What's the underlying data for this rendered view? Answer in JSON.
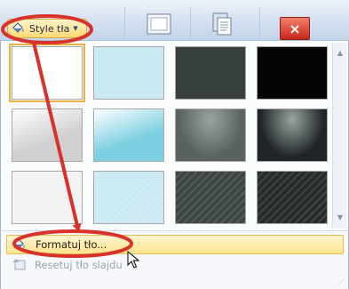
{
  "ribbon": {
    "style_button_label": "Style tła",
    "close_label": "×"
  },
  "gallery": {
    "thumbnails": [
      {
        "fill": "#ffffff",
        "pattern": "plain"
      },
      {
        "fill": "#cbe9f3",
        "pattern": "plain"
      },
      {
        "fill": "#38403f",
        "pattern": "plain"
      },
      {
        "fill": "#050505",
        "pattern": "plain"
      },
      {
        "fill": "#d0d0d0",
        "pattern": "gradient-light"
      },
      {
        "fill": "#7ccfe0",
        "pattern": "gradient-light"
      },
      {
        "fill": "#5a6261",
        "pattern": "radial-dark"
      },
      {
        "fill": "#1f2526",
        "pattern": "radial-dark"
      },
      {
        "fill": "#f3f3f3",
        "pattern": "diagonal"
      },
      {
        "fill": "#cbe9f3",
        "pattern": "diagonal"
      },
      {
        "fill": "#3e4645",
        "pattern": "diagonal"
      },
      {
        "fill": "#262b2c",
        "pattern": "diagonal"
      }
    ]
  },
  "menu": {
    "format_label": "Formatuj tło...",
    "reset_label": "Resetuj tło slajdu"
  },
  "colors": {
    "annotation": "#d8322b",
    "hover_fill": "#ffe38c",
    "selection": "#f0b040"
  }
}
